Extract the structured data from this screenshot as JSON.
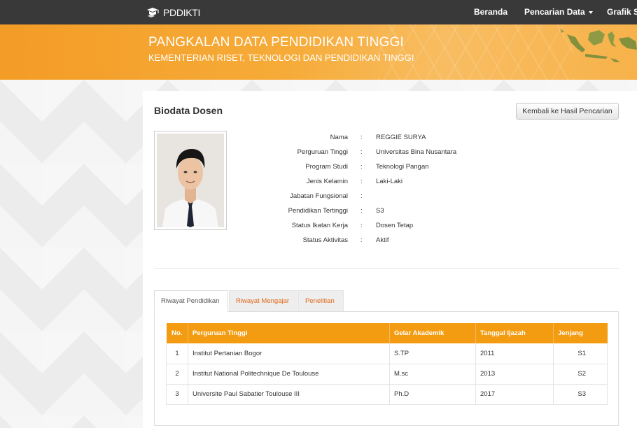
{
  "navbar": {
    "brand": "PDDIKTI",
    "items": [
      {
        "label": "Beranda"
      },
      {
        "label": "Pencarian Data"
      },
      {
        "label": "Grafik St"
      }
    ]
  },
  "banner": {
    "title": "PANGKALAN DATA PENDIDIKAN TINGGI",
    "subtitle": "KEMENTERIAN RISET, TEKNOLOGI DAN PENDIDIKAN TINGGI"
  },
  "page": {
    "title": "Biodata Dosen",
    "back_button": "Kembali ke Hasil Pencarian"
  },
  "biodata": {
    "separator": ":",
    "rows": [
      {
        "label": "Nama",
        "value": "REGGIE SURYA"
      },
      {
        "label": "Perguruan Tinggi",
        "value": "Universitas Bina Nusantara"
      },
      {
        "label": "Program Studi",
        "value": "Teknologi Pangan"
      },
      {
        "label": "Jenis Kelamin",
        "value": "Laki-Laki"
      },
      {
        "label": "Jabatan Fungsional",
        "value": ""
      },
      {
        "label": "Pendidikan Tertinggi",
        "value": "S3"
      },
      {
        "label": "Status Ikatan Kerja",
        "value": "Dosen Tetap"
      },
      {
        "label": "Status Aktivitas",
        "value": "Aktif"
      }
    ]
  },
  "tabs": [
    {
      "label": "Riwayat Pendidikan",
      "active": true
    },
    {
      "label": "Riwayat Mengajar",
      "active": false
    },
    {
      "label": "Penelitian",
      "active": false
    }
  ],
  "education_table": {
    "headers": [
      "No.",
      "Perguruan Tinggi",
      "Gelar Akademik",
      "Tanggal Ijazah",
      "Jenjang"
    ],
    "rows": [
      [
        "1",
        "Institut Pertanian Bogor",
        "S.TP",
        "2011",
        "S1"
      ],
      [
        "2",
        "Institut National Politechnique De Toulouse",
        "M.sc",
        "2013",
        "S2"
      ],
      [
        "3",
        "Universite Paul Sabatier Toulouse III",
        "Ph.D",
        "2017",
        "S3"
      ]
    ]
  },
  "colors": {
    "navbar": "#393939",
    "banner": "#f39c26",
    "table_header": "#f39c12",
    "tab_inactive_text": "#e0671a"
  }
}
